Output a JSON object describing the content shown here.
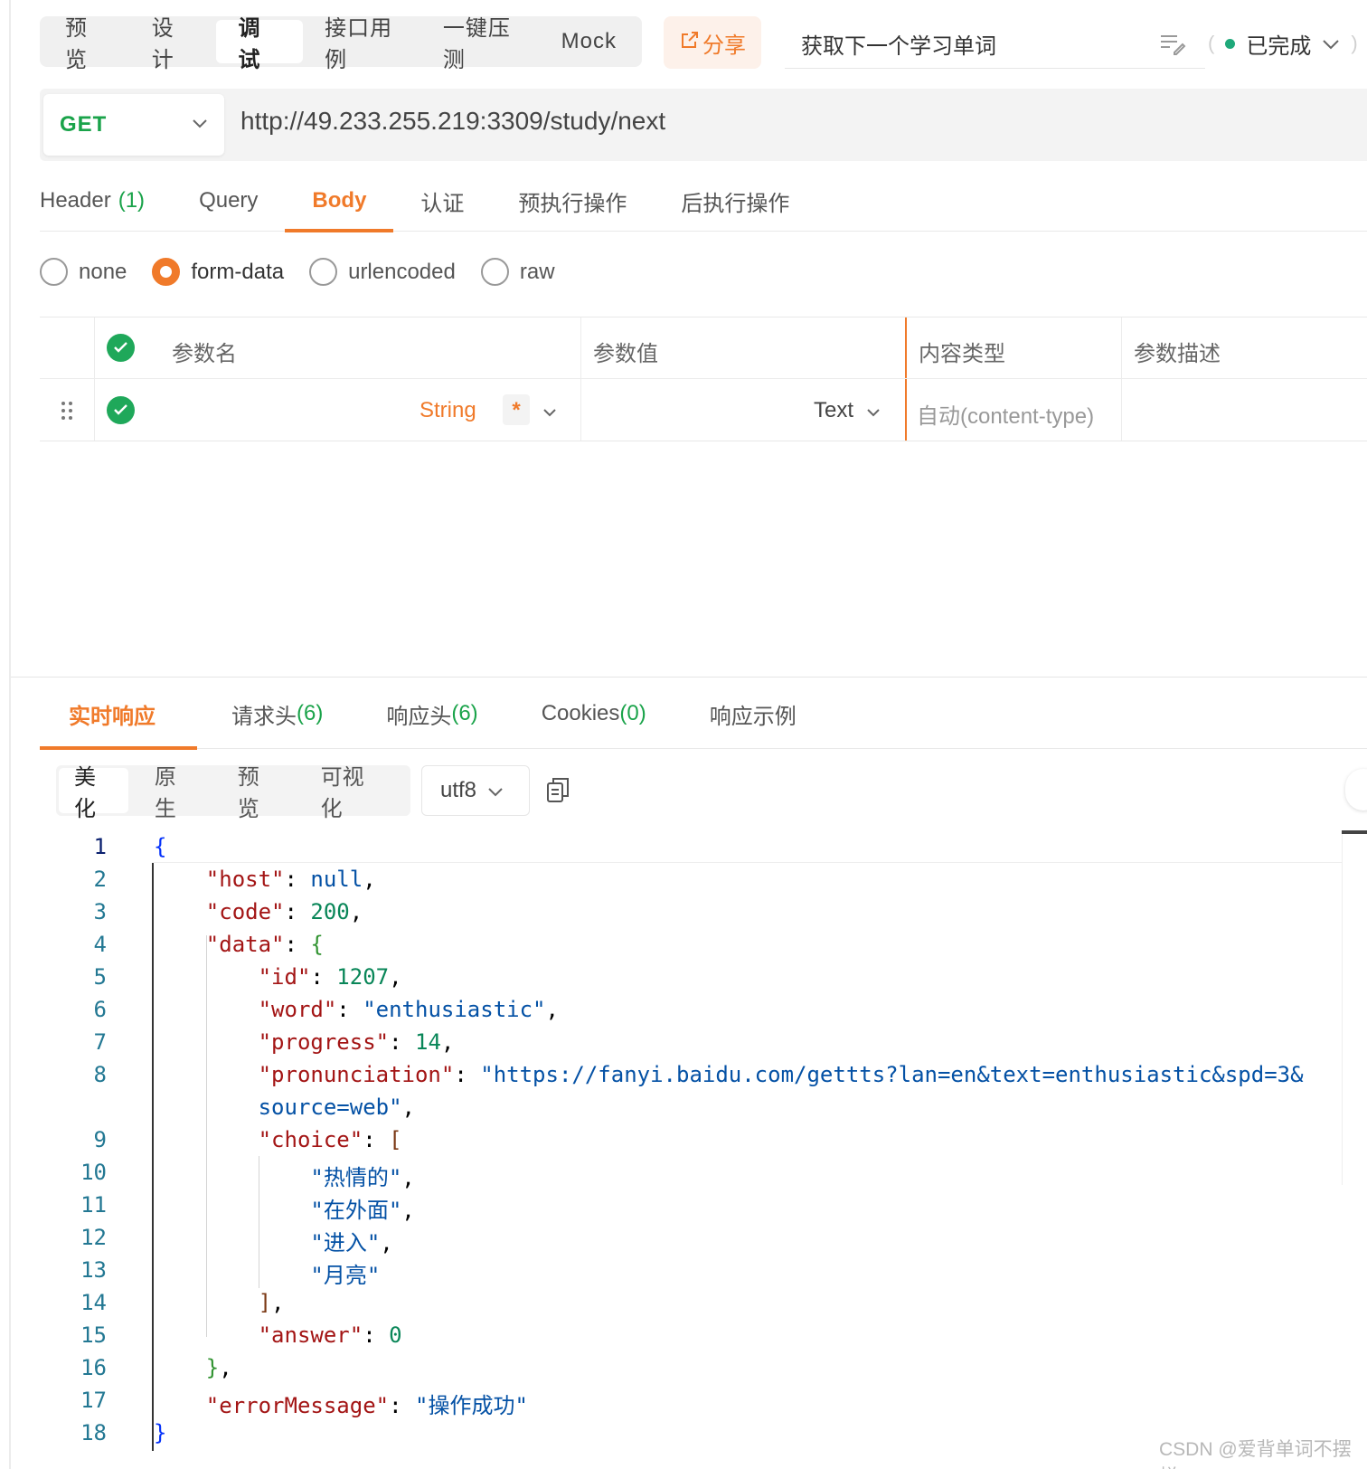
{
  "top_bar": {
    "mode_tabs": [
      "预 览",
      "设 计",
      "调 试",
      "接口用例",
      "一键压测",
      "Mock"
    ],
    "active_mode_index": 2,
    "share_label": "分享",
    "api_title": "获取下一个学习单词",
    "status_label": "已完成",
    "status_color": "#1fa97a"
  },
  "request": {
    "method": "GET",
    "url": "http://49.233.255.219:3309/study/next",
    "tabs": {
      "header": "Header",
      "header_count": "(1)",
      "query": "Query",
      "body": "Body",
      "auth": "认证",
      "pre": "预执行操作",
      "post": "后执行操作"
    },
    "body_types": [
      "none",
      "form-data",
      "urlencoded",
      "raw"
    ],
    "selected_body_type": "form-data",
    "params_table": {
      "columns": [
        "参数名",
        "参数值",
        "内容类型",
        "参数描述"
      ],
      "row": {
        "type": "String",
        "required_mark": "*",
        "value_type": "Text",
        "content_type_placeholder": "自动(content-type)"
      }
    }
  },
  "response": {
    "tabs": {
      "realtime": "实时响应",
      "req_headers": "请求头",
      "req_headers_count": "(6)",
      "resp_headers": "响应头",
      "resp_headers_count": "(6)",
      "cookies": "Cookies",
      "cookies_count": "(0)",
      "example": "响应示例"
    },
    "view_modes": [
      "美化",
      "原生",
      "预览",
      "可视化"
    ],
    "encoding": "utf8",
    "line_numbers": [
      "1",
      "2",
      "3",
      "4",
      "5",
      "6",
      "7",
      "8",
      "9",
      "10",
      "11",
      "12",
      "13",
      "14",
      "15",
      "16",
      "17",
      "18"
    ],
    "code": {
      "open_brace": "{",
      "host_key": "\"host\"",
      "host_val": "null",
      "code_key": "\"code\"",
      "code_val": "200",
      "data_key": "\"data\"",
      "data_open": "{",
      "id_key": "\"id\"",
      "id_val": "1207",
      "word_key": "\"word\"",
      "word_val": "\"enthusiastic\"",
      "progress_key": "\"progress\"",
      "progress_val": "14",
      "pron_key": "\"pronunciation\"",
      "pron_val_1": "\"https://fanyi.baidu.com/gettts?lan=en&text=enthusiastic&spd=3&",
      "pron_val_2": "source=web\"",
      "choice_key": "\"choice\"",
      "choice_open": "[",
      "choice_1": "\"热情的\"",
      "choice_2": "\"在外面\"",
      "choice_3": "\"进入\"",
      "choice_4": "\"月亮\"",
      "choice_close": "]",
      "answer_key": "\"answer\"",
      "answer_val": "0",
      "data_close": "}",
      "err_key": "\"errorMessage\"",
      "err_val": "\"操作成功\"",
      "close_brace": "}"
    }
  },
  "watermark": "CSDN @爱背单词不摆烂",
  "colors": {
    "accent": "#f07a2a",
    "green": "#1aa34a",
    "check_green": "#1fa85a"
  }
}
